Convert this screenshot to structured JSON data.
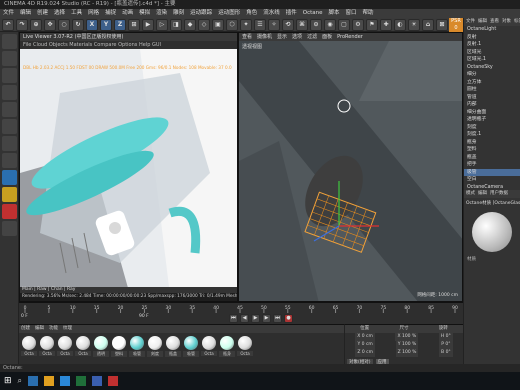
{
  "window": {
    "title": "CINEMA 4D R19.024 Studio (RC - R19) - [瓶盖遗传].c4d *] - 主要"
  },
  "menu": {
    "items": [
      "文件",
      "编辑",
      "创建",
      "选择",
      "工具",
      "网格",
      "捕捉",
      "动画",
      "模拟",
      "渲染",
      "雕刻",
      "运动跟踪",
      "运动图形",
      "角色",
      "流水线",
      "插件",
      "Octane",
      "脚本",
      "窗口",
      "帮助"
    ]
  },
  "toolbar": {
    "buttons": [
      "↶",
      "↷",
      "⊕",
      "✥",
      "○",
      "↻",
      "X",
      "Y",
      "Z",
      "⊞",
      "▶",
      "▷",
      "◨",
      "◆",
      "◇",
      "▣",
      "⬡",
      "✦",
      "☰",
      "✧",
      "⟲",
      "⌘",
      "⊙",
      "◉",
      "▢",
      "⚙",
      "⚑",
      "✚",
      "◐",
      "☀",
      "⌂",
      "⊠"
    ],
    "psr_label": "PSR",
    "psr_value": "0"
  },
  "viewport_left": {
    "title": "Live Viewer 3.07-R2 (中国区正版授权使用)",
    "menu": "File Cloud Objects Materials Compare Options Help GUI",
    "status": "Rendering: 3.56%  Ms/sec: 2.484  Time: 00:00:00/00:00:23  Spp/maxspp: 176/3000  Tri: 0/1.49m  Mesh: 2/1  Hair: 0",
    "info": "DBL Hb 2.03.2  ACCJ 1.50 FDST 00 DRAW 500.0M Free 200 Gms: 96/0.1 Nodes: 108 Movable: 37 0.0"
  },
  "viewport_right": {
    "menu": [
      "查看",
      "摄像机",
      "显示",
      "选项",
      "过滤",
      "面板",
      "ProRender"
    ],
    "label": "透视视图",
    "distance": "网格间距: 1000 cm"
  },
  "objects": {
    "tabs": [
      "文件",
      "编辑",
      "查看",
      "对象",
      "标签",
      "书签"
    ],
    "items": [
      "OctaneLight",
      "反射",
      "反射.1",
      "区域光",
      "区域光.1",
      "OctaneSky",
      "细分",
      "立方体",
      "圆柱",
      "管道",
      "内部",
      "细分曲面",
      "透明瓶子",
      "刻度",
      "刻度.1",
      "瓶身",
      "塑料",
      "瓶盖",
      "把手",
      "吸管",
      "空白",
      "OctaneCamera"
    ]
  },
  "attributes": {
    "tabs": [
      "模式",
      "编辑",
      "用户数据"
    ],
    "name": "Octane材质 [OctaneGlass]",
    "label": "材质"
  },
  "timeline": {
    "frames": [
      "0",
      "5",
      "10",
      "15",
      "20",
      "25",
      "30",
      "35",
      "40",
      "45",
      "50",
      "55",
      "60",
      "65",
      "70",
      "75",
      "80",
      "85",
      "90"
    ],
    "current": "0 F",
    "end": "90 F"
  },
  "materials": {
    "tabs": [
      "创建",
      "编辑",
      "功能",
      "纹理"
    ],
    "items": [
      "Octa",
      "Octa",
      "Octa",
      "Octa",
      "透明",
      "塑料",
      "吸管",
      "刻度",
      "瓶盖",
      "吸管",
      "Octa",
      "瓶身",
      "Octa"
    ]
  },
  "coords": {
    "headers": [
      "位置",
      "尺寸",
      "旋转"
    ],
    "rows": [
      [
        "X 0 cm",
        "X 100 %",
        "H 0°"
      ],
      [
        "Y 0 cm",
        "Y 100 %",
        "P 0°"
      ],
      [
        "Z 0 cm",
        "Z 100 %",
        "B 0°"
      ]
    ],
    "mode": "对象(相对)",
    "apply": "应用"
  },
  "status": {
    "text": "Octane:"
  },
  "taskbar": {
    "time": ""
  }
}
